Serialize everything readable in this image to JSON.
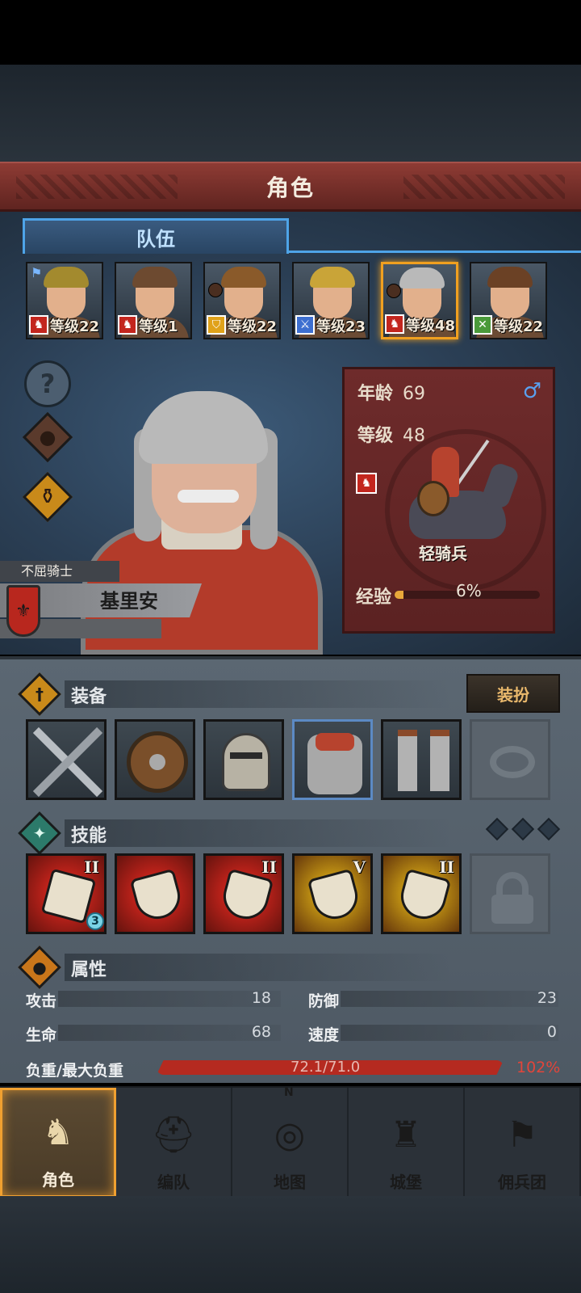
{
  "title": "角色",
  "tabs": {
    "team": "队伍"
  },
  "roster": [
    {
      "level_text": "等级22",
      "class_icon": "cavalry-icon",
      "class_color": "#c3261e",
      "hair_color": "#a38a2e",
      "leader": true
    },
    {
      "level_text": "等级1",
      "class_icon": "cavalry-icon",
      "class_color": "#c3261e",
      "hair_color": "#6d4a30"
    },
    {
      "level_text": "等级22",
      "class_icon": "shield-icon",
      "class_color": "#e0a21a",
      "hair_color": "#8a5a2a",
      "badge": true
    },
    {
      "level_text": "等级23",
      "class_icon": "sword-icon",
      "class_color": "#3d6fd0",
      "hair_color": "#c9a438"
    },
    {
      "level_text": "等级48",
      "class_icon": "cavalry-icon",
      "class_color": "#c3261e",
      "hair_color": "#b9b9b9",
      "selected": true,
      "badge": true
    },
    {
      "level_text": "等级22",
      "class_icon": "crossed-swords-icon",
      "class_color": "#4a9a3a",
      "hair_color": "#6b4125"
    }
  ],
  "hero": {
    "title": "不屈骑士",
    "name": "基里安",
    "age_label": "年龄",
    "age": "69",
    "level_label": "等级",
    "level": "48",
    "gender_symbol": "♂",
    "class_name": "轻骑兵",
    "exp_label": "经验",
    "exp_percent_text": "6%",
    "exp_fraction": 0.06,
    "crest_color": "#b8271e"
  },
  "equipment": {
    "label": "装备",
    "dress_button": "装扮",
    "slots": [
      "sword",
      "shield",
      "helmet",
      "chainmail-armor",
      "chainmail-boots",
      "ring-empty"
    ]
  },
  "skills": {
    "label": "技能",
    "items": [
      {
        "icon": "sword-strike-icon",
        "rank": "II",
        "color": "#c9241c",
        "charges": "3"
      },
      {
        "icon": "shield-bash-icon",
        "rank": "",
        "color": "#c9241c"
      },
      {
        "icon": "shield-bash-strike-icon",
        "rank": "II",
        "color": "#c9241c"
      },
      {
        "icon": "shield-break-icon",
        "rank": "V",
        "color": "#c89a14"
      },
      {
        "icon": "kite-shield-icon",
        "rank": "II",
        "color": "#c89a14"
      },
      {
        "icon": "lock-icon",
        "rank": "",
        "color": "#5a636c",
        "locked": true
      }
    ]
  },
  "attributes": {
    "label": "属性",
    "attack_label": "攻击",
    "attack": "18",
    "defense_label": "防御",
    "defense": "23",
    "hp_label": "生命",
    "hp": "68",
    "speed_label": "速度",
    "speed": "0",
    "load_label": "负重/最大负重",
    "load_text": "72.1/71.0",
    "load_percent": "102%"
  },
  "nav": [
    {
      "label": "角色",
      "icon": "knight-icon",
      "active": true
    },
    {
      "label": "编队",
      "icon": "formation-helmet-icon"
    },
    {
      "label": "地图",
      "icon": "compass-map-icon",
      "compass_letter": "N"
    },
    {
      "label": "城堡",
      "icon": "castle-icon"
    },
    {
      "label": "佣兵团",
      "icon": "mercenary-banner-icon"
    }
  ]
}
